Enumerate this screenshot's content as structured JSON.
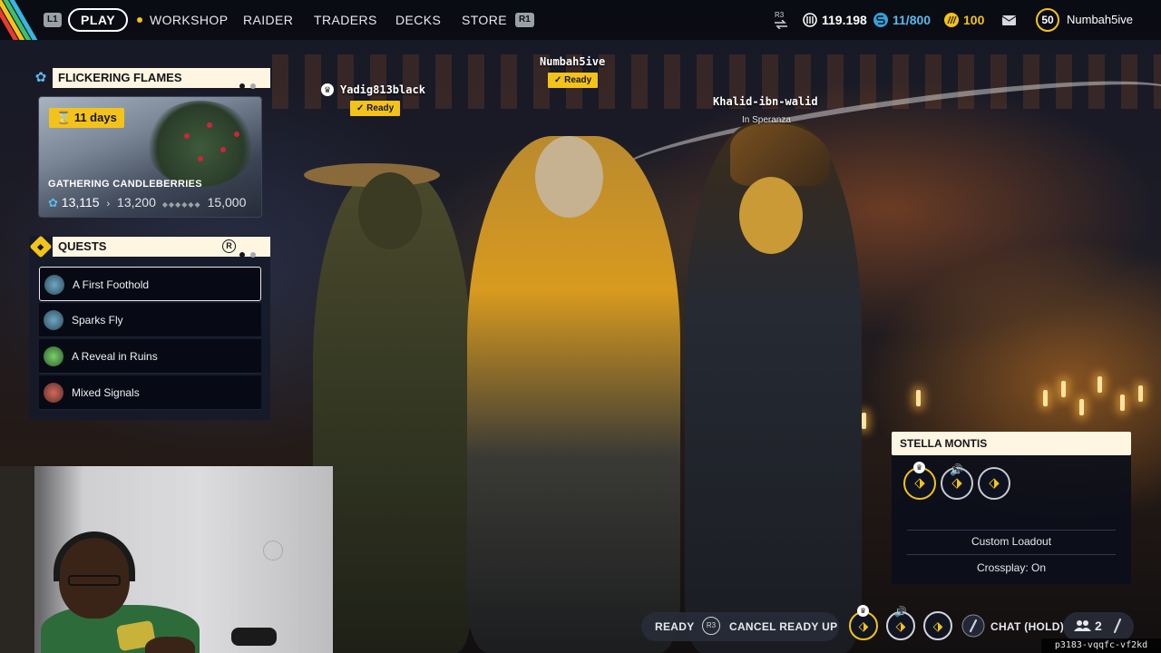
{
  "topbar": {
    "l1": "L1",
    "r1": "R1",
    "play": "PLAY",
    "nav": [
      "WORKSHOP",
      "RAIDER",
      "TRADERS",
      "DECKS",
      "STORE"
    ],
    "r3": "R3",
    "currency_credits": "119.198",
    "currency_storage": "11/800",
    "currency_coins": "100",
    "level": "50",
    "username": "Numbah5ive"
  },
  "event": {
    "title": "FLICKERING FLAMES",
    "timer": "11 days",
    "name": "GATHERING CANDLEBERRIES",
    "progress_current": "13,115",
    "progress_next": "13,200",
    "progress_max": "15,000"
  },
  "quests": {
    "title": "QUESTS",
    "button_hint": "R",
    "items": [
      {
        "label": "A First Foothold"
      },
      {
        "label": "Sparks Fly"
      },
      {
        "label": "A Reveal in Ruins"
      },
      {
        "label": "Mixed Signals"
      }
    ]
  },
  "players": [
    {
      "name": "Yadig813black",
      "status": "Ready"
    },
    {
      "name": "Numbah5ive",
      "status": "Ready"
    },
    {
      "name": "Khalid-ibn-walid",
      "status": "In Speranza"
    }
  ],
  "map_card": {
    "title": "STELLA MONTIS",
    "loadout": "Custom Loadout",
    "crossplay": "Crossplay: On"
  },
  "bottombar": {
    "ready": "READY",
    "r3": "R3",
    "cancel": "CANCEL READY UP",
    "chat": "CHAT (HOLD)",
    "party_count": "2"
  },
  "lobby_code": "p3183-vqqfc-vf2kd",
  "colors": {
    "accent_yellow": "#f3c31a",
    "header_cream": "#fff6e2",
    "panel_dark": "#070a14"
  }
}
